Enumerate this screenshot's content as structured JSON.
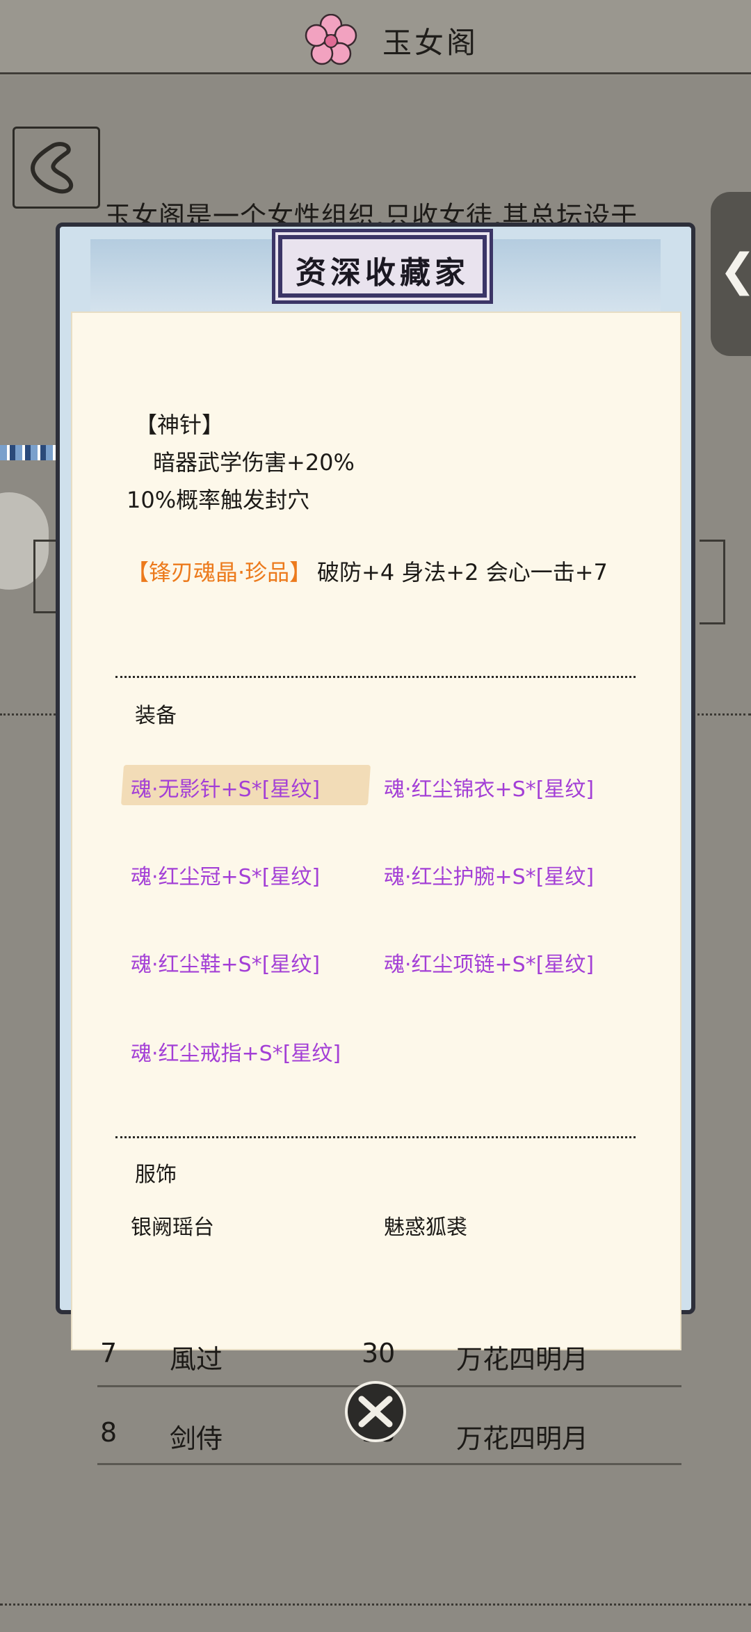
{
  "header": {
    "title": "玉女阁"
  },
  "background": {
    "intro": "玉女阁是一个女性组织,只收女徒,其总坛设于",
    "rows": [
      {
        "rank": "7",
        "name": "風过",
        "level": "30",
        "school": "万花四明月"
      },
      {
        "rank": "8",
        "name": "剑侍",
        "level": "38",
        "school": "万花四明月"
      }
    ]
  },
  "modal": {
    "title": "资深收藏家",
    "skill_name": "【神针】",
    "skill_line1": "暗器武学伤害+20%",
    "skill_line2": "10%概率触发封穴",
    "gem_label": "【锋刃魂晶·珍品】",
    "gem_stats": "破防+4 身法+2 会心一击+7",
    "equipment_header": "装备",
    "equipment": [
      "魂·无影针+S*[星纹]",
      "魂·红尘锦衣+S*[星纹]",
      "魂·红尘冠+S*[星纹]",
      "魂·红尘护腕+S*[星纹]",
      "魂·红尘鞋+S*[星纹]",
      "魂·红尘项链+S*[星纹]",
      "魂·红尘戒指+S*[星纹]"
    ],
    "costume_header": "服饰",
    "costumes": [
      "银阙瑶台",
      "魅惑狐裘"
    ]
  },
  "colors": {
    "gem": "#ec7a1c",
    "equipment": "#a33fd6",
    "paper": "#fdf8ea"
  },
  "icons": [
    "flower-icon",
    "back-icon",
    "chevron-left-icon",
    "close-icon"
  ]
}
